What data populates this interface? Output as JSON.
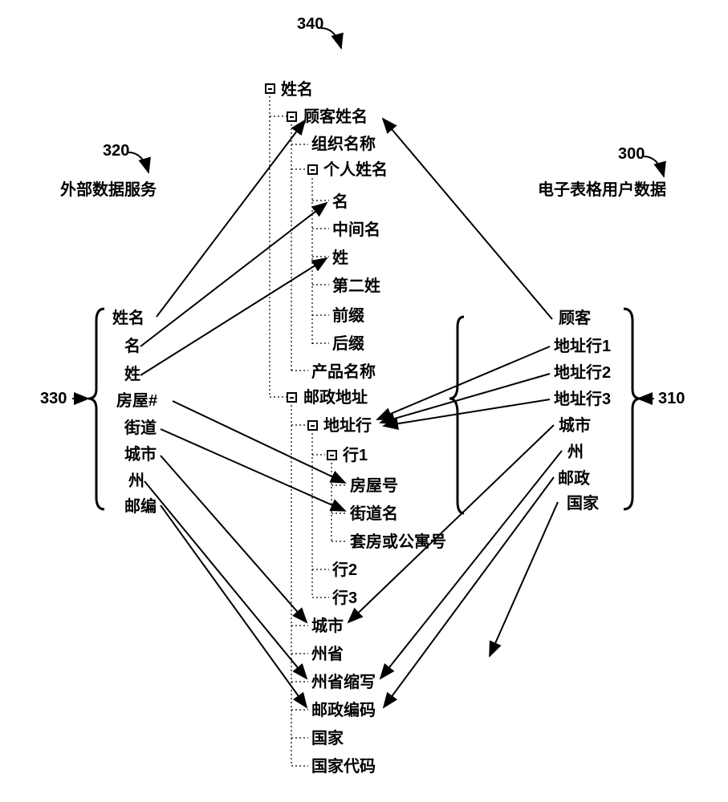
{
  "refs": {
    "r300": "300",
    "r310": "310",
    "r320": "320",
    "r330": "330",
    "r340": "340"
  },
  "left": {
    "title": "外部数据服务",
    "items": {
      "name": "姓名",
      "given": "名",
      "surname": "姓",
      "house": "房屋#",
      "street": "街道",
      "city": "城市",
      "state": "州",
      "zip": "邮编"
    }
  },
  "right": {
    "title": "电子表格用户数据",
    "items": {
      "customer": "顾客",
      "addr1": "地址行1",
      "addr2": "地址行2",
      "addr3": "地址行3",
      "city": "城市",
      "state": "州",
      "postal": "邮政",
      "country": "国家"
    }
  },
  "tree": {
    "name": "姓名",
    "custname": "顾客姓名",
    "orgname": "组织名称",
    "personname": "个人姓名",
    "given": "名",
    "middle": "中间名",
    "surname": "姓",
    "second_surname": "第二姓",
    "prefix": "前缀",
    "suffix": "后缀",
    "product": "产品名称",
    "postal_addr": "邮政地址",
    "addr_line": "地址行",
    "line1": "行1",
    "house_no": "房屋号",
    "street_name": "街道名",
    "apt": "套房或公寓号",
    "line2": "行2",
    "line3": "行3",
    "city": "城市",
    "state_prov": "州省",
    "state_abbr": "州省缩写",
    "postal_code": "邮政编码",
    "country": "国家",
    "country_code": "国家代码"
  }
}
